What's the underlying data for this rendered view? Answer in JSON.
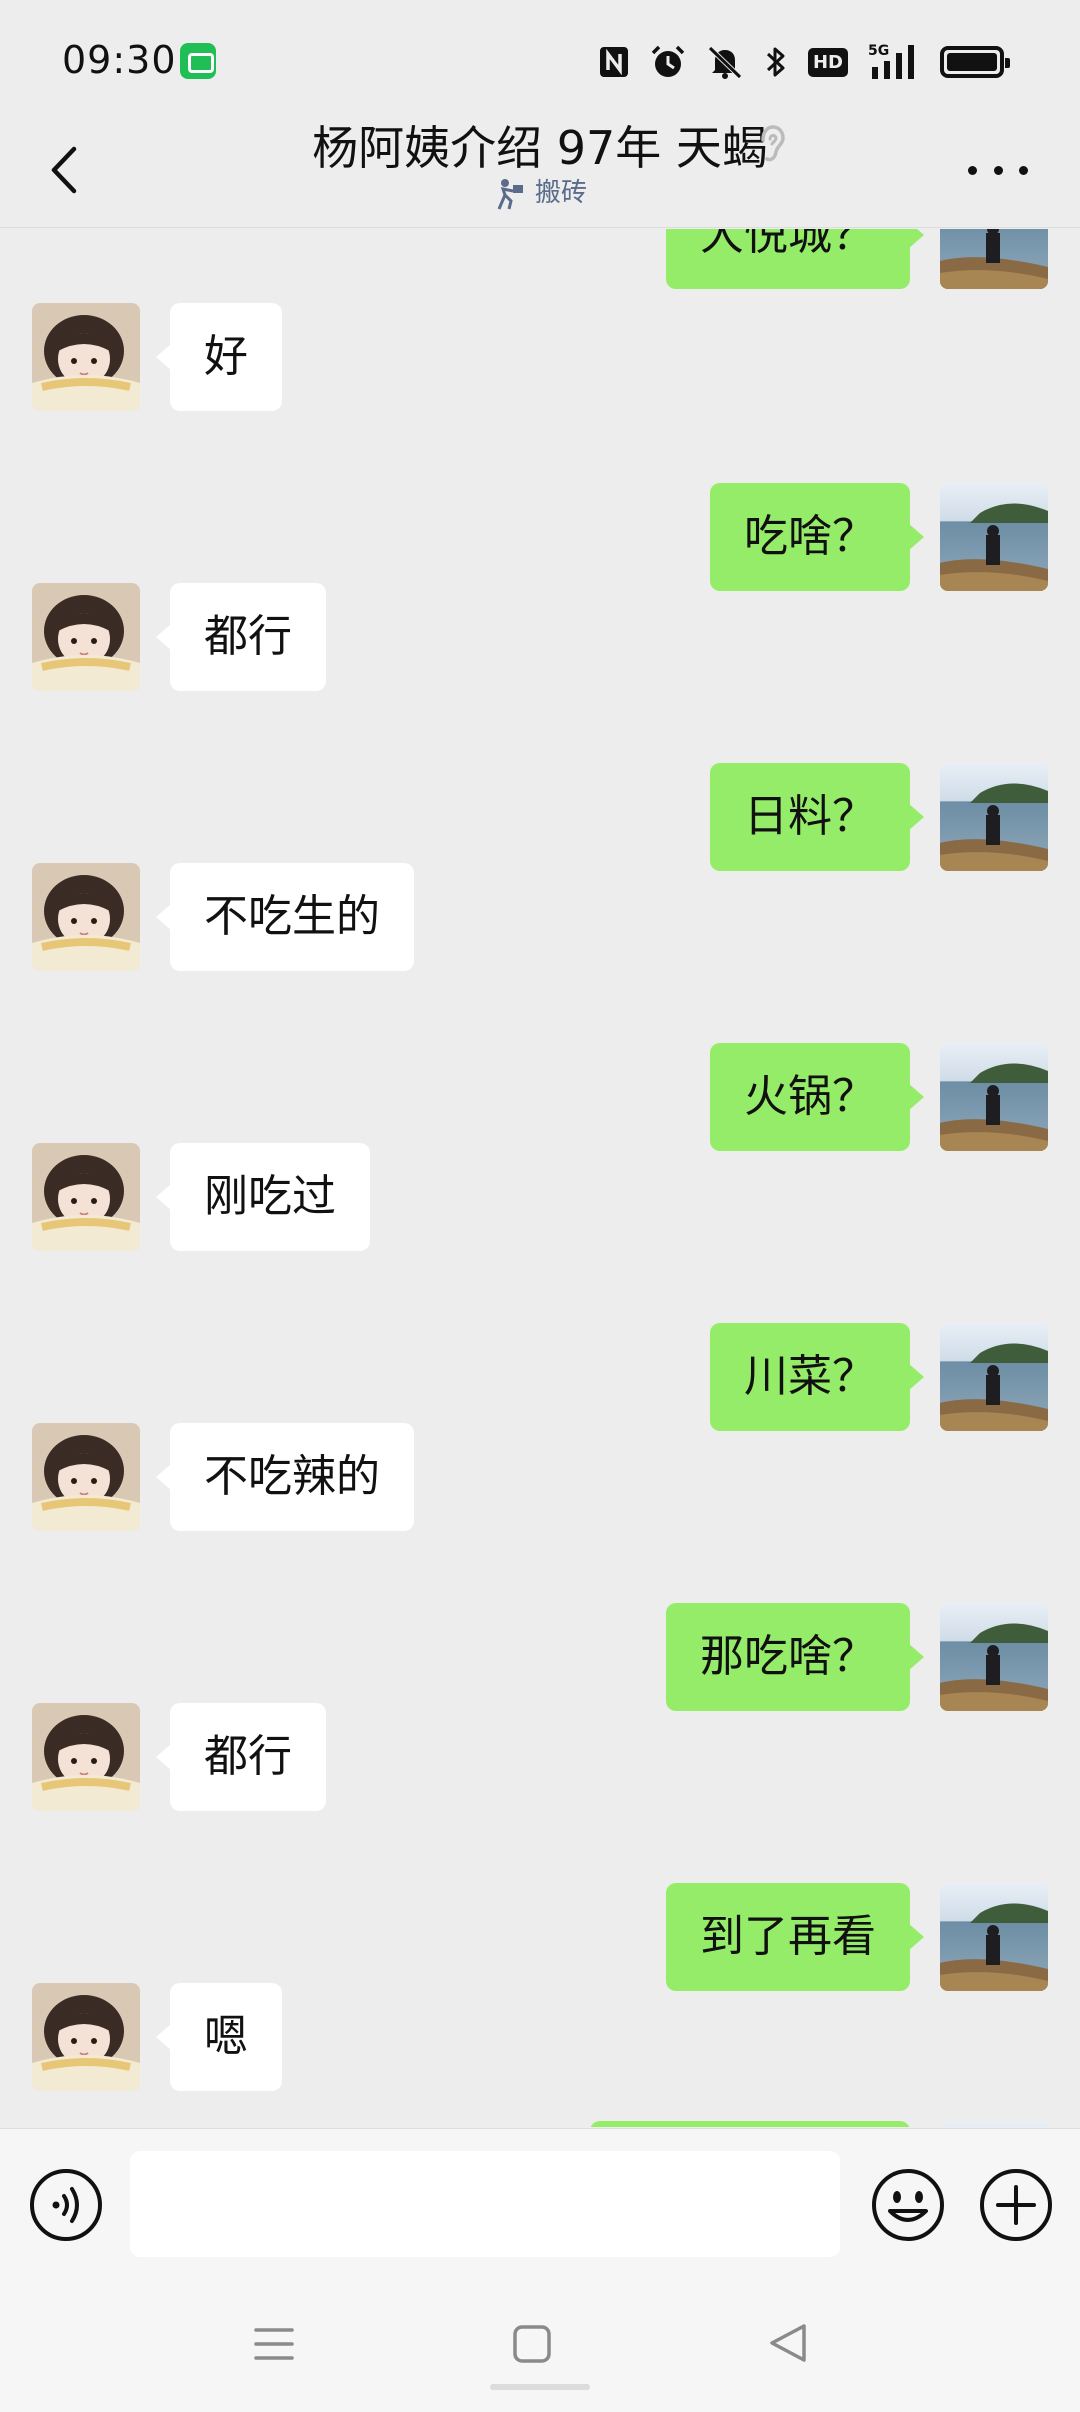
{
  "status_bar": {
    "time": "09:30",
    "icons": [
      "wechat-notification-icon",
      "nfc-icon",
      "alarm-icon",
      "mute-icon",
      "bluetooth-icon",
      "hd-icon",
      "signal-5g-icon",
      "battery-icon"
    ],
    "hd_label": "HD",
    "network_label": "5G"
  },
  "header": {
    "title": "杨阿姨介绍 97年 天蝎",
    "status_text": "搬砖",
    "back_icon": "chevron-left-icon",
    "more_icon": "more-dots-icon",
    "ear_icon": "earpiece-mode-icon"
  },
  "messages": [
    {
      "side": "right",
      "text": "大悦城？"
    },
    {
      "side": "left",
      "text": "好"
    },
    {
      "side": "right",
      "text": "吃啥？"
    },
    {
      "side": "left",
      "text": "都行"
    },
    {
      "side": "right",
      "text": "日料？"
    },
    {
      "side": "left",
      "text": "不吃生的"
    },
    {
      "side": "right",
      "text": "火锅？"
    },
    {
      "side": "left",
      "text": "刚吃过"
    },
    {
      "side": "right",
      "text": "川菜？"
    },
    {
      "side": "left",
      "text": "不吃辣的"
    },
    {
      "side": "right",
      "text": "那吃啥？"
    },
    {
      "side": "left",
      "text": "都行"
    },
    {
      "side": "right",
      "text": "到了再看"
    },
    {
      "side": "left",
      "text": "嗯"
    },
    {
      "side": "right",
      "text": ""
    }
  ],
  "input_bar": {
    "value": "",
    "voice_icon": "voice-input-icon",
    "emoji_icon": "emoji-icon",
    "plus_icon": "plus-circle-icon"
  },
  "nav_bar": {
    "icons": [
      "menu-icon",
      "home-square-icon",
      "back-triangle-icon"
    ]
  },
  "colors": {
    "background": "#ededed",
    "sent_bubble": "#95ec69",
    "received_bubble": "#ffffff",
    "status_text": "#5a6b8c"
  }
}
